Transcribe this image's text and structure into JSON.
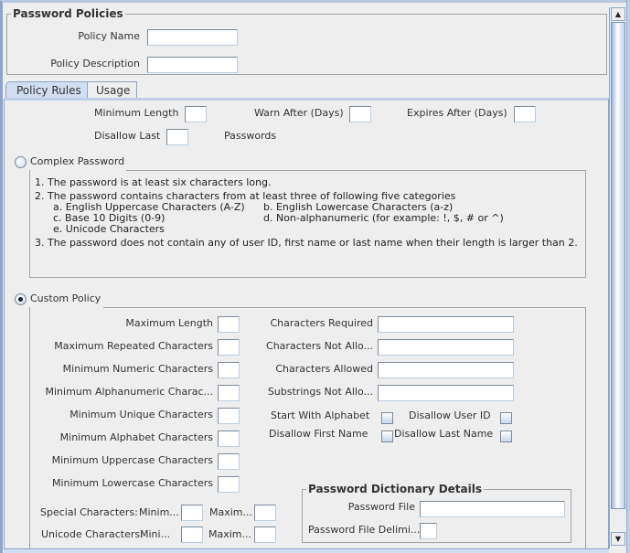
{
  "password_policies": {
    "title": "Password Policies",
    "policy_name_label": "Policy Name",
    "policy_name_value": "",
    "policy_description_label": "Policy Description",
    "policy_description_value": ""
  },
  "tabs": [
    {
      "label": "Policy Rules",
      "selected": true
    },
    {
      "label": "Usage",
      "selected": false
    }
  ],
  "general": {
    "minimum_length_label": "Minimum Length",
    "minimum_length_value": "",
    "warn_after_label": "Warn After (Days)",
    "warn_after_value": "",
    "expires_after_label": "Expires After (Days)",
    "expires_after_value": "",
    "disallow_last_label": "Disallow Last",
    "disallow_last_value": "",
    "passwords_label": "Passwords"
  },
  "complex_password": {
    "label": "Complex Password",
    "selected": false,
    "rules": {
      "r1": "1. The password is at least six characters long.",
      "r2": "2. The password contains characters from at least three of following five categories",
      "a": "a. English Uppercase Characters (A-Z)",
      "b": "b. English Lowercase Characters (a-z)",
      "c": "c. Base 10 Digits (0-9)",
      "d": "d. Non-alphanumeric (for example: !, $, # or ^)",
      "e": "e. Unicode Characters",
      "r3": "3. The password does not contain any of user ID, first name or last name when their length is larger than 2."
    }
  },
  "custom_policy": {
    "label": "Custom Policy",
    "selected": true,
    "left_fields": [
      {
        "label": "Maximum Length",
        "value": ""
      },
      {
        "label": "Maximum Repeated Characters",
        "value": ""
      },
      {
        "label": "Minimum Numeric Characters",
        "value": ""
      },
      {
        "label": "Minimum Alphanumeric Charac...",
        "value": ""
      },
      {
        "label": "Minimum Unique Characters",
        "value": ""
      },
      {
        "label": "Minimum Alphabet Characters",
        "value": ""
      },
      {
        "label": "Minimum Uppercase Characters",
        "value": ""
      },
      {
        "label": "Minimum Lowercase Characters",
        "value": ""
      }
    ],
    "right_fields": [
      {
        "label": "Characters Required",
        "value": ""
      },
      {
        "label": "Characters Not Allo...",
        "value": ""
      },
      {
        "label": "Characters Allowed",
        "value": ""
      },
      {
        "label": "Substrings Not Allo...",
        "value": ""
      }
    ],
    "checkboxes": {
      "start_with_alphabet": {
        "label": "Start With Alphabet",
        "checked": false
      },
      "disallow_user_id": {
        "label": "Disallow User ID",
        "checked": false
      },
      "disallow_first_name": {
        "label": "Disallow First Name",
        "checked": false
      },
      "disallow_last_name": {
        "label": "Disallow Last Name",
        "checked": false
      }
    },
    "special_characters": {
      "label": "Special Characters:",
      "min_label": "Minim...",
      "min_value": "",
      "max_label": "Maxim...",
      "max_value": ""
    },
    "unicode_characters": {
      "label": "Unicode Characters:",
      "min_label": "Mini...",
      "min_value": "",
      "max_label": "Maxim...",
      "max_value": ""
    }
  },
  "dictionary": {
    "title": "Password Dictionary Details",
    "password_file_label": "Password File",
    "password_file_value": "",
    "delimiter_label": "Password File Delimi...",
    "delimiter_value": ""
  },
  "scrollbar": {
    "up_icon": "▲",
    "down_icon": "▼"
  }
}
